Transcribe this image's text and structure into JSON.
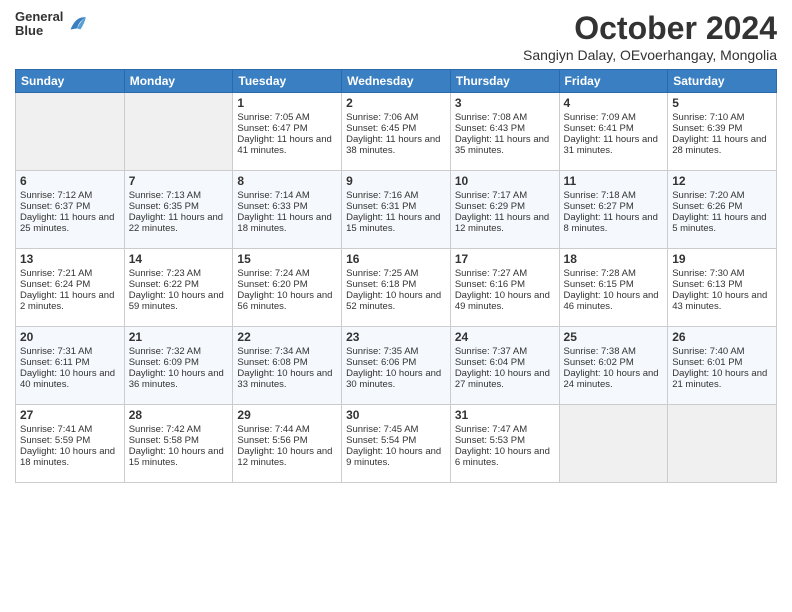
{
  "logo": {
    "general": "General",
    "blue": "Blue"
  },
  "header": {
    "title": "October 2024",
    "location": "Sangiyn Dalay, OEvoerhangay, Mongolia"
  },
  "columns": [
    "Sunday",
    "Monday",
    "Tuesday",
    "Wednesday",
    "Thursday",
    "Friday",
    "Saturday"
  ],
  "weeks": [
    [
      {
        "day": "",
        "content": ""
      },
      {
        "day": "",
        "content": ""
      },
      {
        "day": "1",
        "content": "Sunrise: 7:05 AM\nSunset: 6:47 PM\nDaylight: 11 hours and 41 minutes."
      },
      {
        "day": "2",
        "content": "Sunrise: 7:06 AM\nSunset: 6:45 PM\nDaylight: 11 hours and 38 minutes."
      },
      {
        "day": "3",
        "content": "Sunrise: 7:08 AM\nSunset: 6:43 PM\nDaylight: 11 hours and 35 minutes."
      },
      {
        "day": "4",
        "content": "Sunrise: 7:09 AM\nSunset: 6:41 PM\nDaylight: 11 hours and 31 minutes."
      },
      {
        "day": "5",
        "content": "Sunrise: 7:10 AM\nSunset: 6:39 PM\nDaylight: 11 hours and 28 minutes."
      }
    ],
    [
      {
        "day": "6",
        "content": "Sunrise: 7:12 AM\nSunset: 6:37 PM\nDaylight: 11 hours and 25 minutes."
      },
      {
        "day": "7",
        "content": "Sunrise: 7:13 AM\nSunset: 6:35 PM\nDaylight: 11 hours and 22 minutes."
      },
      {
        "day": "8",
        "content": "Sunrise: 7:14 AM\nSunset: 6:33 PM\nDaylight: 11 hours and 18 minutes."
      },
      {
        "day": "9",
        "content": "Sunrise: 7:16 AM\nSunset: 6:31 PM\nDaylight: 11 hours and 15 minutes."
      },
      {
        "day": "10",
        "content": "Sunrise: 7:17 AM\nSunset: 6:29 PM\nDaylight: 11 hours and 12 minutes."
      },
      {
        "day": "11",
        "content": "Sunrise: 7:18 AM\nSunset: 6:27 PM\nDaylight: 11 hours and 8 minutes."
      },
      {
        "day": "12",
        "content": "Sunrise: 7:20 AM\nSunset: 6:26 PM\nDaylight: 11 hours and 5 minutes."
      }
    ],
    [
      {
        "day": "13",
        "content": "Sunrise: 7:21 AM\nSunset: 6:24 PM\nDaylight: 11 hours and 2 minutes."
      },
      {
        "day": "14",
        "content": "Sunrise: 7:23 AM\nSunset: 6:22 PM\nDaylight: 10 hours and 59 minutes."
      },
      {
        "day": "15",
        "content": "Sunrise: 7:24 AM\nSunset: 6:20 PM\nDaylight: 10 hours and 56 minutes."
      },
      {
        "day": "16",
        "content": "Sunrise: 7:25 AM\nSunset: 6:18 PM\nDaylight: 10 hours and 52 minutes."
      },
      {
        "day": "17",
        "content": "Sunrise: 7:27 AM\nSunset: 6:16 PM\nDaylight: 10 hours and 49 minutes."
      },
      {
        "day": "18",
        "content": "Sunrise: 7:28 AM\nSunset: 6:15 PM\nDaylight: 10 hours and 46 minutes."
      },
      {
        "day": "19",
        "content": "Sunrise: 7:30 AM\nSunset: 6:13 PM\nDaylight: 10 hours and 43 minutes."
      }
    ],
    [
      {
        "day": "20",
        "content": "Sunrise: 7:31 AM\nSunset: 6:11 PM\nDaylight: 10 hours and 40 minutes."
      },
      {
        "day": "21",
        "content": "Sunrise: 7:32 AM\nSunset: 6:09 PM\nDaylight: 10 hours and 36 minutes."
      },
      {
        "day": "22",
        "content": "Sunrise: 7:34 AM\nSunset: 6:08 PM\nDaylight: 10 hours and 33 minutes."
      },
      {
        "day": "23",
        "content": "Sunrise: 7:35 AM\nSunset: 6:06 PM\nDaylight: 10 hours and 30 minutes."
      },
      {
        "day": "24",
        "content": "Sunrise: 7:37 AM\nSunset: 6:04 PM\nDaylight: 10 hours and 27 minutes."
      },
      {
        "day": "25",
        "content": "Sunrise: 7:38 AM\nSunset: 6:02 PM\nDaylight: 10 hours and 24 minutes."
      },
      {
        "day": "26",
        "content": "Sunrise: 7:40 AM\nSunset: 6:01 PM\nDaylight: 10 hours and 21 minutes."
      }
    ],
    [
      {
        "day": "27",
        "content": "Sunrise: 7:41 AM\nSunset: 5:59 PM\nDaylight: 10 hours and 18 minutes."
      },
      {
        "day": "28",
        "content": "Sunrise: 7:42 AM\nSunset: 5:58 PM\nDaylight: 10 hours and 15 minutes."
      },
      {
        "day": "29",
        "content": "Sunrise: 7:44 AM\nSunset: 5:56 PM\nDaylight: 10 hours and 12 minutes."
      },
      {
        "day": "30",
        "content": "Sunrise: 7:45 AM\nSunset: 5:54 PM\nDaylight: 10 hours and 9 minutes."
      },
      {
        "day": "31",
        "content": "Sunrise: 7:47 AM\nSunset: 5:53 PM\nDaylight: 10 hours and 6 minutes."
      },
      {
        "day": "",
        "content": ""
      },
      {
        "day": "",
        "content": ""
      }
    ]
  ]
}
